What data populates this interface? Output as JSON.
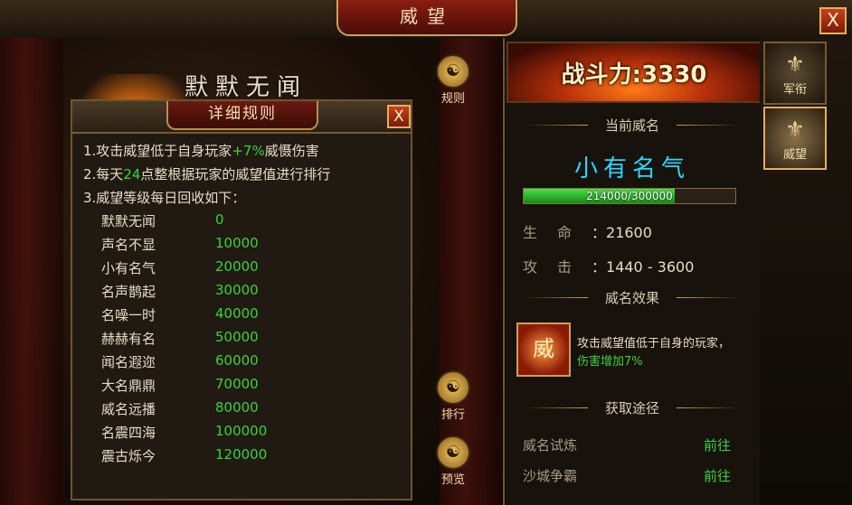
{
  "window": {
    "title": "威望",
    "close_glyph": "X"
  },
  "scene": {
    "rank_title": "默默无闻"
  },
  "side_buttons": [
    {
      "label": "规则",
      "icon": "rule-icon"
    },
    {
      "label": "排行",
      "icon": "rank-list-icon"
    },
    {
      "label": "预览",
      "icon": "preview-icon"
    }
  ],
  "popup": {
    "title": "详细规则",
    "close_glyph": "X",
    "rule1": {
      "prefix": "1.攻击威望低于自身玩家",
      "highlight": "+7%",
      "suffix": "威慑伤害"
    },
    "rule2": {
      "prefix": "2.每天",
      "highlight": "24",
      "suffix": "点整根据玩家的威望值进行排行"
    },
    "rule3": "3.威望等级每日回收如下：",
    "levels": [
      {
        "name": "默默无闻",
        "value": "0"
      },
      {
        "name": "声名不显",
        "value": "10000"
      },
      {
        "name": "小有名气",
        "value": "20000"
      },
      {
        "name": "名声鹊起",
        "value": "30000"
      },
      {
        "name": "名噪一时",
        "value": "40000"
      },
      {
        "name": "赫赫有名",
        "value": "50000"
      },
      {
        "name": "闻名遐迩",
        "value": "60000"
      },
      {
        "name": "大名鼎鼎",
        "value": "70000"
      },
      {
        "name": "威名远播",
        "value": "80000"
      },
      {
        "name": "名震四海",
        "value": "100000"
      },
      {
        "name": "震古烁今",
        "value": "120000"
      }
    ]
  },
  "panel": {
    "power_text": "战斗力:3330",
    "current_title": "当前威名",
    "current_rank": "小有名气",
    "progress": {
      "current": 214000,
      "max": 300000,
      "text": "214000/300000"
    },
    "stats": [
      {
        "label": "生命",
        "value": "：21600"
      },
      {
        "label": "攻击",
        "value": "：1440 - 3600"
      }
    ],
    "effect_title": "威名效果",
    "effect_icon_text": "威",
    "effect_line1": "攻击威望值低于自身的玩家，",
    "effect_line2": "伤害增加7%",
    "route_title": "获取途径",
    "routes": [
      {
        "name": "威名试炼",
        "link": "前往"
      },
      {
        "name": "沙城争霸",
        "link": "前往"
      }
    ]
  },
  "tabs": [
    {
      "label": "军衔",
      "icon": "military-rank-icon"
    },
    {
      "label": "威望",
      "icon": "prestige-icon",
      "active": true
    }
  ],
  "colors": {
    "highlight_green": "#3ad43a",
    "rank_cyan": "#2ad8ff",
    "gold_border": "#c9a060"
  }
}
